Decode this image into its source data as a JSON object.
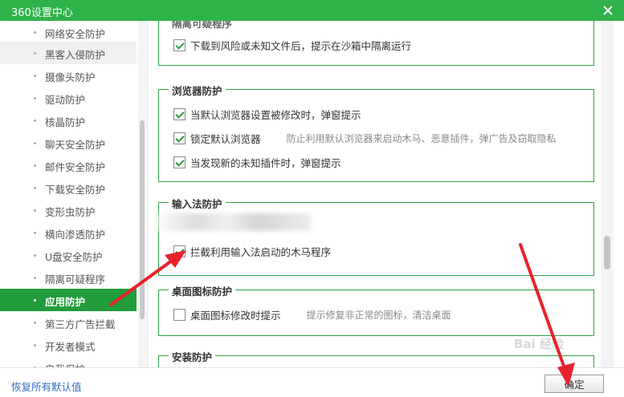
{
  "window": {
    "title": "360设置中心",
    "colors": {
      "titlebar": "#2fb24a",
      "active_item": "#219c3b",
      "group_border": "#2fa443",
      "link": "#2f6ec4",
      "annotation_arrow": "#e8222c"
    }
  },
  "sidebar": {
    "items": [
      {
        "label": "网络安全防护",
        "state": "normal"
      },
      {
        "label": "黑客入侵防护",
        "state": "hover"
      },
      {
        "label": "摄像头防护",
        "state": "normal"
      },
      {
        "label": "驱动防护",
        "state": "normal"
      },
      {
        "label": "核晶防护",
        "state": "normal"
      },
      {
        "label": "聊天安全防护",
        "state": "normal"
      },
      {
        "label": "邮件安全防护",
        "state": "normal"
      },
      {
        "label": "下载安全防护",
        "state": "normal"
      },
      {
        "label": "变形虫防护",
        "state": "normal"
      },
      {
        "label": "横向渗透防护",
        "state": "normal"
      },
      {
        "label": "U盘安全防护",
        "state": "normal"
      },
      {
        "label": "隔离可疑程序",
        "state": "normal"
      },
      {
        "label": "应用防护",
        "state": "active"
      },
      {
        "label": "第三方广告拦截",
        "state": "normal"
      },
      {
        "label": "开发者模式",
        "state": "normal"
      },
      {
        "label": "自我保护",
        "state": "normal"
      }
    ]
  },
  "groups": {
    "isolate": {
      "title": "隔离可疑程序",
      "options": [
        {
          "label": "下载到风险或未知文件后，提示在沙箱中隔离运行",
          "checked": true,
          "hint": ""
        }
      ]
    },
    "browser": {
      "title": "浏览器防护",
      "options": [
        {
          "label": "当默认浏览器设置被修改时，弹窗提示",
          "checked": true,
          "hint": ""
        },
        {
          "label": "锁定默认浏览器",
          "checked": true,
          "hint": "防止利用默认浏览器来启动木马、恶意插件，弹广告及窃取隐私"
        },
        {
          "label": "当发现新的未知插件时，弹窗提示",
          "checked": true,
          "hint": ""
        }
      ]
    },
    "ime": {
      "title": "输入法防护",
      "options": [
        {
          "label": "拦截利用输入法启动的木马程序",
          "checked": true,
          "hint": ""
        }
      ]
    },
    "desktop": {
      "title": "桌面图标防护",
      "options": [
        {
          "label": "桌面图标修改时提示",
          "checked": false,
          "hint": "提示修复非正常的图标，清洁桌面"
        }
      ]
    },
    "install": {
      "title": "安装防护",
      "options": []
    }
  },
  "footer": {
    "restore_label": "恢复所有默认值",
    "ok_label": "确定"
  },
  "watermark": "Bai 经验"
}
